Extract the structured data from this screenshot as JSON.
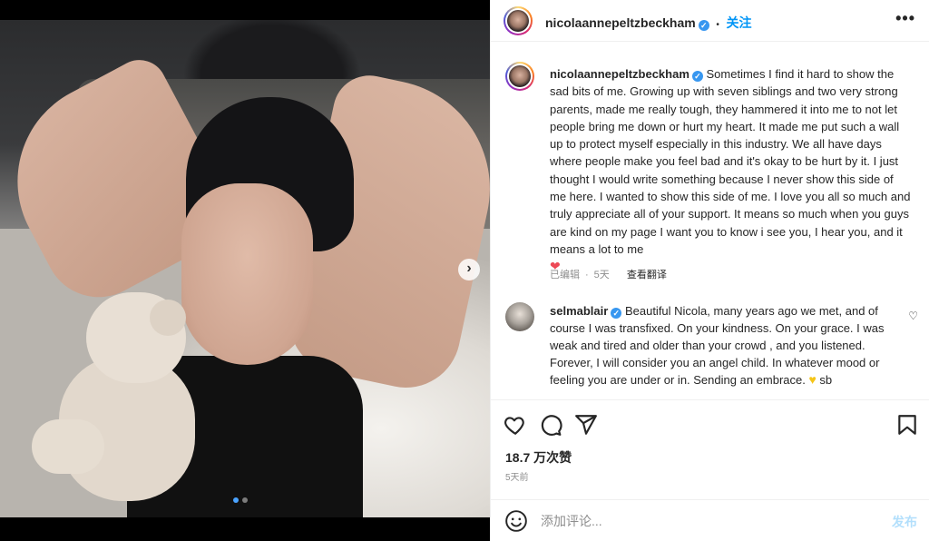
{
  "post": {
    "username": "nicolaannepeltzbeckham",
    "verified_mark": "✓",
    "follow_label": "关注",
    "separator": "•",
    "more_label": "•••"
  },
  "caption": {
    "username": "nicolaannepeltzbeckham",
    "text": "Sometimes I find it hard to show the sad bits of me. Growing up with seven siblings and two very strong parents, made me really tough, they hammered it into me to not let people bring me down or hurt my heart. It made me put such a wall up to protect myself especially in this industry. We all have days where people make you feel bad and it's okay to be hurt by it. I just thought I would write something because I never show this side of me here. I wanted to show this side of me. I love you all so much and truly appreciate all of your support. It means so much when you guys are kind on my page I want you to know i see you, I hear you, and it means a lot to me",
    "emoji": "❤",
    "edited_label": "已编辑",
    "separator": "·",
    "age": "5天",
    "translate_label": "查看翻译"
  },
  "comment": {
    "username": "selmablair",
    "text": "Beautiful Nicola, many years ago we met, and of course I was transfixed. On your kindness. On your grace. I was weak and tired and older than your crowd , and you listened. Forever, I will consider you an angel child. In whatever mood or feeling you are under or in. Sending an embrace.",
    "emoji": "♥",
    "signature": "sb",
    "like_icon": "♡"
  },
  "engagement": {
    "likes": "18.7 万次赞",
    "time": "5天前"
  },
  "composer": {
    "placeholder": "添加评论...",
    "post_label": "发布",
    "emoji_icon": "smiley-icon"
  },
  "carousel": {
    "next_symbol": "›",
    "slide_count": 2,
    "current_slide": 1
  },
  "colors": {
    "link_blue": "#0095f6",
    "verified_blue": "#3897f0",
    "muted_gray": "#8e8e8e",
    "post_disabled": "#b2dffc"
  }
}
